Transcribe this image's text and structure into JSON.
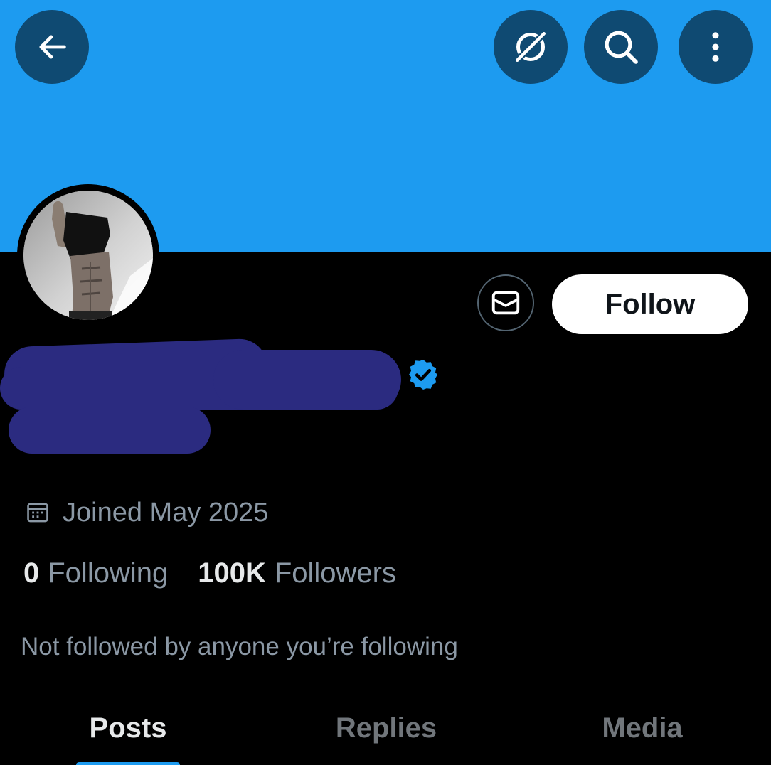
{
  "header": {
    "back_icon": "arrow-left-icon",
    "grok_icon": "grok-icon",
    "search_icon": "search-icon",
    "more_icon": "more-vertical-icon",
    "banner_color": "#1d9bf0",
    "button_color": "#0f4a72"
  },
  "profile": {
    "avatar_icon": "profile-photo",
    "verified_icon": "verified-badge-icon",
    "joined_icon": "calendar-icon",
    "joined_text": "Joined May 2025",
    "following_count": "0",
    "following_label": "Following",
    "followers_count": "100K",
    "followers_label": "Followers",
    "not_followed_text": "Not followed by anyone you’re following"
  },
  "actions": {
    "message_icon": "envelope-icon",
    "follow_label": "Follow"
  },
  "tabs": [
    {
      "label": "Posts"
    },
    {
      "label": "Replies"
    },
    {
      "label": "Media"
    }
  ],
  "colors": {
    "accent": "#1d9bf0",
    "background": "#000000",
    "redaction": "#2b2b80"
  }
}
